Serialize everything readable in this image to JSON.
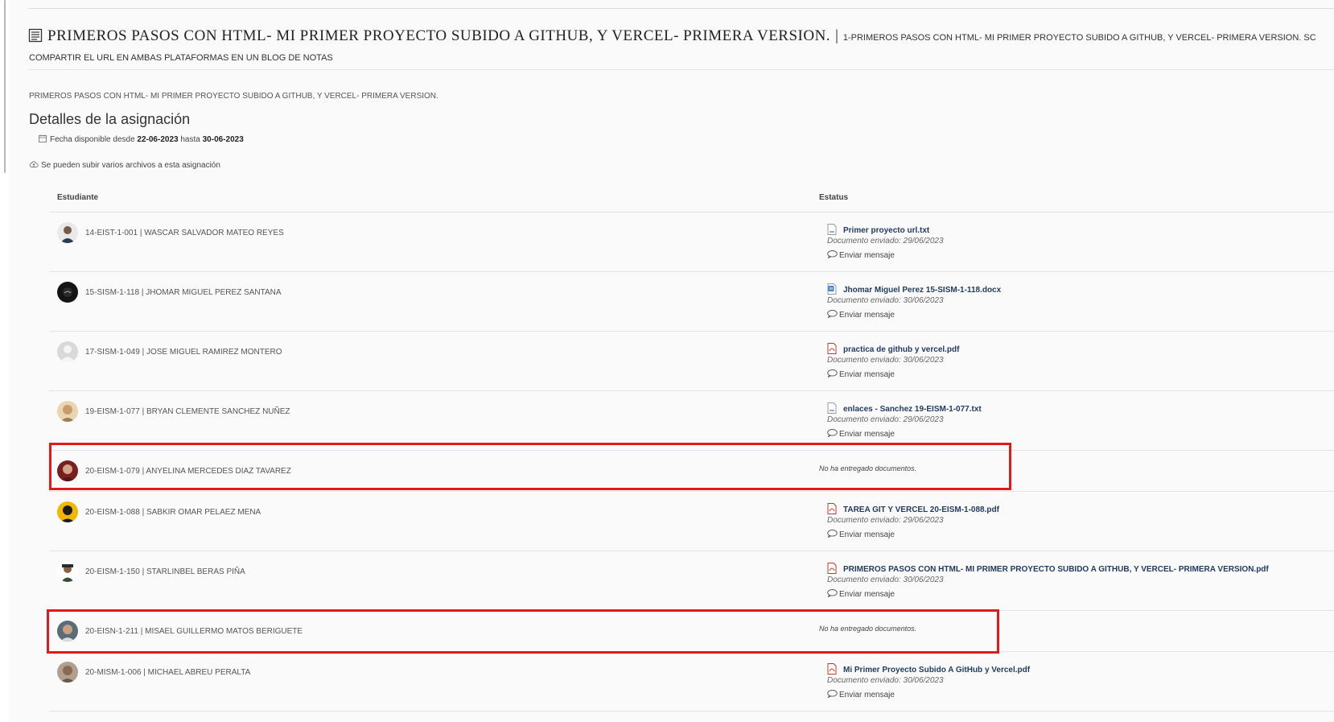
{
  "assignment": {
    "title_main": "PRIMEROS PASOS CON HTML- MI PRIMER PROYECTO SUBIDO A GITHUB, Y VERCEL- PRIMERA VERSION.",
    "title_separator": "|",
    "title_sub": "1-PRIMEROS PASOS CON HTML- MI PRIMER PROYECTO SUBIDO A GITHUB, Y VERCEL- PRIMERA VERSION. SC",
    "title_line2": "COMPARTIR EL URL EN AMBAS PLATAFORMAS EN UN BLOG DE NOTAS",
    "description": "PRIMEROS PASOS CON HTML- MI PRIMER PROYECTO SUBIDO A GITHUB, Y VERCEL- PRIMERA VERSION.",
    "details_heading": "Detalles de la asignación",
    "date_prefix": "Fecha disponible desde",
    "date_from": "22-06-2023",
    "date_middle": "hasta",
    "date_to": "30-06-2023",
    "upload_note": "Se pueden subir varios archivos a esta asignación"
  },
  "table": {
    "header_student": "Estudiante",
    "header_status": "Estatus",
    "sent_label_prefix": "Documento enviado:",
    "message_label": "Enviar mensaje",
    "no_docs_label": "No ha entregado documentos.",
    "rows": [
      {
        "student": "14-EIST-1-001 | WASCAR SALVADOR MATEO REYES",
        "file": "Primer proyecto url.txt",
        "file_type": "txt-file-icon",
        "sent": "Documento enviado: 29/06/2023"
      },
      {
        "student": "15-SISM-1-118 | JHOMAR MIGUEL PEREZ SANTANA",
        "file": "Jhomar Miguel Perez 15-SISM-1-118.docx",
        "file_type": "docx-file-icon",
        "sent": "Documento enviado: 30/06/2023"
      },
      {
        "student": "17-SISM-1-049 | JOSE MIGUEL RAMIREZ MONTERO",
        "file": "practica de github y vercel.pdf",
        "file_type": "pdf-file-icon",
        "sent": "Documento enviado: 30/06/2023"
      },
      {
        "student": "19-EISM-1-077 | BRYAN CLEMENTE SANCHEZ NUÑEZ",
        "file": "enlaces - Sanchez 19-EISM-1-077.txt",
        "file_type": "txt-file-icon",
        "sent": "Documento enviado: 29/06/2023"
      },
      {
        "student": "20-EISM-1-079 | ANYELINA MERCEDES DIAZ TAVAREZ",
        "status": "No ha entregado documentos."
      },
      {
        "student": "20-EISM-1-088 | SABKIR OMAR PELAEZ MENA",
        "file": "TAREA GIT Y VERCEL 20-EISM-1-088.pdf",
        "file_type": "pdf-file-icon",
        "sent": "Documento enviado: 29/06/2023"
      },
      {
        "student": "20-EISM-1-150 | STARLINBEL  BERAS PIÑA",
        "file": "PRIMEROS PASOS CON HTML- MI PRIMER PROYECTO SUBIDO A GITHUB, Y VERCEL- PRIMERA VERSION.pdf",
        "file_type": "pdf-file-icon",
        "sent": "Documento enviado: 30/06/2023"
      },
      {
        "student": "20-EISN-1-211 | MISAEL GUILLERMO MATOS BERIGUETE",
        "status": "No ha entregado documentos."
      },
      {
        "student": "20-MISM-1-006 | MICHAEL  ABREU PERALTA",
        "file": "Mi Primer Proyecto Subido A GitHub y Vercel.pdf",
        "file_type": "pdf-file-icon",
        "sent": "Documento enviado: 30/06/2023"
      }
    ]
  },
  "colors": {
    "highlight": "#e2191b",
    "link": "#1f3a5f",
    "background": "#fafafa"
  }
}
